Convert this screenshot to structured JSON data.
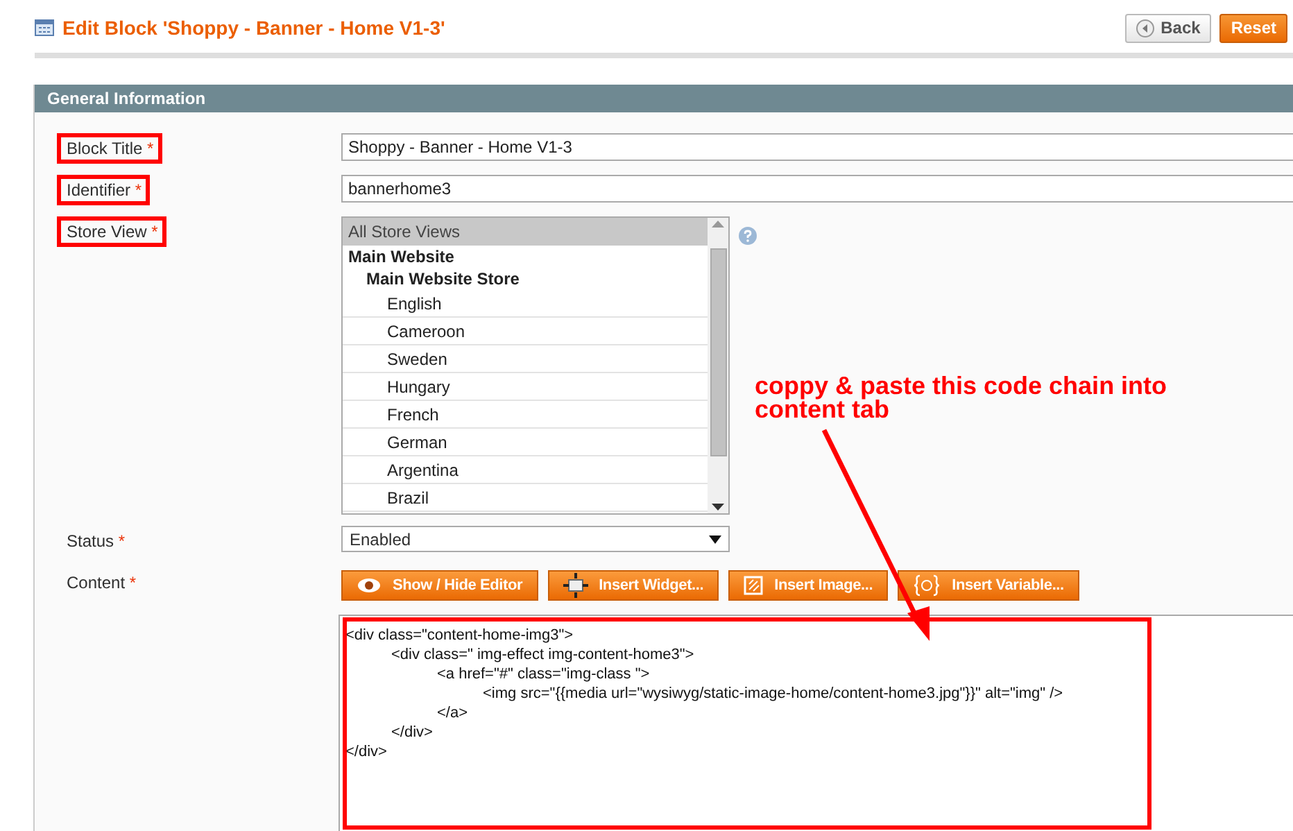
{
  "page_title": "Edit Block 'Shoppy - Banner - Home V1-3'",
  "header_buttons": [
    {
      "label": "Back",
      "kind": "back"
    },
    {
      "label": "Reset",
      "kind": "primary"
    }
  ],
  "section": {
    "title": "General Information"
  },
  "fields": [
    {
      "label": "Block Title",
      "required": "*",
      "highlighted": true,
      "kind": "text",
      "value": "Shoppy - Banner - Home V1-3"
    },
    {
      "label": "Identifier",
      "required": "*",
      "highlighted": true,
      "kind": "text",
      "value": "bannerhome3"
    },
    {
      "label": "Store View",
      "required": "*",
      "highlighted": true,
      "kind": "multiselect",
      "options": [
        {
          "label": "All Store Views",
          "kind": "option",
          "selected": true
        },
        {
          "label": "Main Website",
          "kind": "group",
          "children": [
            {
              "label": "Main Website Store",
              "kind": "group",
              "children": [
                {
                  "label": "English",
                  "kind": "option",
                  "selected": false
                },
                {
                  "label": "Cameroon",
                  "kind": "option",
                  "selected": false
                },
                {
                  "label": "Sweden",
                  "kind": "option",
                  "selected": false
                },
                {
                  "label": "Hungary",
                  "kind": "option",
                  "selected": false
                },
                {
                  "label": "French",
                  "kind": "option",
                  "selected": false
                },
                {
                  "label": "German",
                  "kind": "option",
                  "selected": false
                },
                {
                  "label": "Argentina",
                  "kind": "option",
                  "selected": false
                },
                {
                  "label": "Brazil",
                  "kind": "option",
                  "selected": false
                }
              ]
            }
          ]
        }
      ]
    },
    {
      "label": "Status",
      "required": "*",
      "highlighted": false,
      "kind": "select",
      "value": "Enabled"
    },
    {
      "label": "Content",
      "required": "*",
      "highlighted": false,
      "kind": "editor",
      "buttons": [
        {
          "label": "Show / Hide Editor",
          "kind": "eye"
        },
        {
          "label": "Insert Widget...",
          "kind": "widget"
        },
        {
          "label": "Insert Image...",
          "kind": "image"
        },
        {
          "label": "Insert Variable...",
          "kind": "variable"
        }
      ],
      "code": [
        {
          "text": "<div class=\"content-home-img3\">",
          "children": [
            {
              "text": "<div class=\" img-effect img-content-home3\">",
              "children": [
                {
                  "text": "<a href=\"#\" class=\"img-class \">",
                  "children": [
                    {
                      "text": "<img src=\"{{media url=\"wysiwyg/static-image-home/content-home3.jpg\"}}\" alt=\"img\" />"
                    }
                  ]
                },
                {
                  "text": "</a>"
                }
              ]
            },
            {
              "text": "</div>"
            }
          ]
        },
        {
          "text": "</div>"
        }
      ]
    }
  ],
  "annotation": {
    "text": "coppy & paste this code chain into content tab"
  }
}
